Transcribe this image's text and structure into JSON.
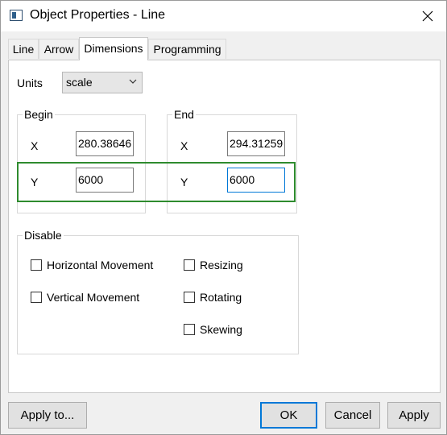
{
  "window": {
    "title": "Object Properties - Line"
  },
  "tabs": [
    {
      "label": "Line",
      "active": false
    },
    {
      "label": "Arrow",
      "active": false
    },
    {
      "label": "Dimensions",
      "active": true
    },
    {
      "label": "Programming",
      "active": false
    }
  ],
  "units": {
    "label": "Units",
    "value": "scale"
  },
  "begin": {
    "title": "Begin",
    "x_label": "X",
    "x_value": "280.38646",
    "y_label": "Y",
    "y_value": "6000"
  },
  "end": {
    "title": "End",
    "x_label": "X",
    "x_value": "294.31259",
    "y_label": "Y",
    "y_value": "6000"
  },
  "disable": {
    "title": "Disable",
    "options": [
      {
        "label": "Horizontal Movement",
        "checked": false
      },
      {
        "label": "Vertical Movement",
        "checked": false
      },
      {
        "label": "Resizing",
        "checked": false
      },
      {
        "label": "Rotating",
        "checked": false
      },
      {
        "label": "Skewing",
        "checked": false
      }
    ]
  },
  "buttons": {
    "apply_to": "Apply to...",
    "ok": "OK",
    "cancel": "Cancel",
    "apply": "Apply"
  },
  "colors": {
    "highlight": "#2e8b2e",
    "focus": "#0078d7"
  },
  "icons": {
    "app": "line-object-icon",
    "close": "close-icon",
    "dropdown": "chevron-down-icon"
  }
}
